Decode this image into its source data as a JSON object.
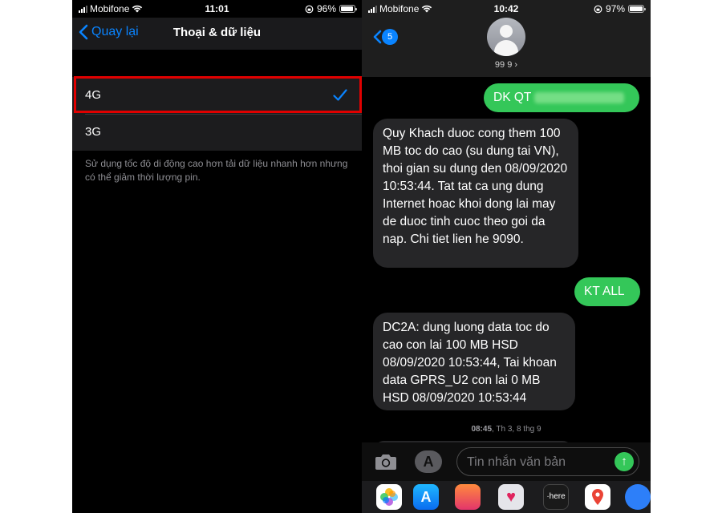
{
  "left_screen": {
    "status": {
      "carrier": "Mobifone",
      "time": "11:01",
      "battery": "96%",
      "battery_level": 0.96
    },
    "nav": {
      "back_label": "Quay lại",
      "title": "Thoại & dữ liệu"
    },
    "options": [
      {
        "label": "4G",
        "selected": true
      },
      {
        "label": "3G",
        "selected": false
      }
    ],
    "footer": "Sử dụng tốc độ di động cao hơn tải dữ liệu nhanh hơn nhưng có thể giảm thời lượng pin.",
    "colors": {
      "accent": "#0a84ff",
      "highlight": "#e00000"
    }
  },
  "right_screen": {
    "status": {
      "carrier": "Mobifone",
      "time": "10:42",
      "battery": "97%",
      "battery_level": 0.97
    },
    "header": {
      "back_badge": "5",
      "contact": "99 9 ›"
    },
    "messages": [
      {
        "from": "me",
        "text": "DK QT"
      },
      {
        "from": "them",
        "text": "Quy Khach duoc cong them 100 MB toc do cao (su dung tai VN), thoi gian su dung den 08/09/2020 10:53:44. Tat tat ca ung dung Internet hoac khoi dong lai may de duoc tinh cuoc theo goi da nap. Chi tiet lien he 9090."
      },
      {
        "from": "me",
        "text": "KT ALL"
      },
      {
        "from": "them",
        "text": "DC2A: dung luong data toc do cao con lai 100 MB HSD 08/09/2020 10:53:44, Tai khoan data GPRS_U2 con lai 0 MB HSD 08/09/2020 10:53:44"
      }
    ],
    "timestamp": {
      "time": "08:45",
      "date": ", Th 3, 8 thg 9"
    },
    "composer": {
      "placeholder": "Tin nhắn văn bản"
    },
    "tray_apps": [
      "photos-icon",
      "appstore-icon",
      "game-icon",
      "heart-icon",
      "here-icon",
      "maps-icon",
      "globe-icon"
    ],
    "tray_labels": {
      "here": "·here"
    },
    "colors": {
      "sent": "#34c759",
      "received": "#262628",
      "accent": "#0a84ff"
    }
  }
}
